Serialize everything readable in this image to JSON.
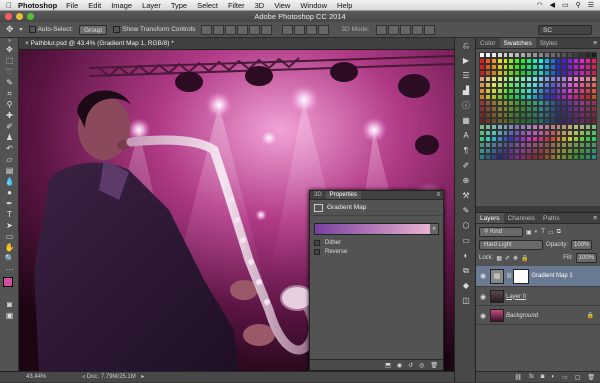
{
  "menubar": {
    "app": "Photoshop",
    "items": [
      "File",
      "Edit",
      "Image",
      "Layer",
      "Type",
      "Select",
      "Filter",
      "3D",
      "View",
      "Window",
      "Help"
    ]
  },
  "window": {
    "title": "Adobe Photoshop CC 2014"
  },
  "options": {
    "auto_select_label": "Auto-Select:",
    "auto_select_value": "Group",
    "transform_label": "Show Transform Controls",
    "mode_label": "3D Mode:",
    "workspace": "SC"
  },
  "document": {
    "tab_label": "× Pathblur.psd @ 43.4% (Gradient Map 1, RGB/8) *",
    "zoom": "43.44%",
    "doc_info": "Doc: 7.79M/25.1M"
  },
  "swatches_panel": {
    "tabs": [
      "Color",
      "Swatches",
      "Styles"
    ],
    "active_tab": "Swatches"
  },
  "properties_panel": {
    "tabs": [
      "3D",
      "Properties"
    ],
    "title": "Gradient Map",
    "dither_label": "Dither",
    "reverse_label": "Reverse"
  },
  "layers_panel": {
    "tabs": [
      "Layers",
      "Channels",
      "Paths"
    ],
    "filter": "Kind",
    "blend_mode": "Hard Light",
    "opacity_label": "Opacity:",
    "opacity_value": "100%",
    "lock_label": "Lock:",
    "fill_label": "Fill:",
    "fill_value": "100%",
    "layers": [
      {
        "name": "Gradient Map 1"
      },
      {
        "name": "Layer 0"
      },
      {
        "name": "Background"
      }
    ]
  },
  "colors": {
    "foreground": "#d24fa0",
    "background": "#ffffff"
  }
}
